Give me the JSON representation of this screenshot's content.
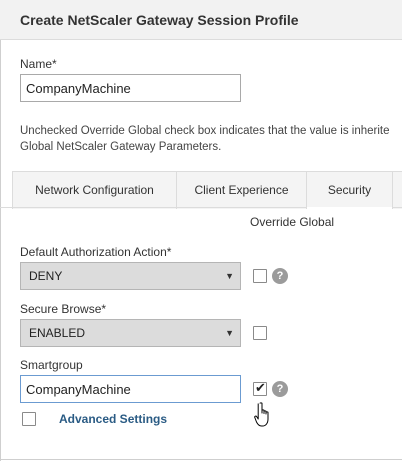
{
  "window": {
    "title": "Create NetScaler Gateway Session Profile"
  },
  "name_field": {
    "label": "Name*",
    "value": "CompanyMachine"
  },
  "info_text": {
    "line1": "Unchecked Override Global check box indicates that the value is inherite",
    "line2": "Global NetScaler Gateway Parameters."
  },
  "tabs": [
    {
      "label": "Network Configuration",
      "active": false
    },
    {
      "label": "Client Experience",
      "active": false
    },
    {
      "label": "Security",
      "active": true
    }
  ],
  "override_global_header": "Override Global",
  "default_authorization": {
    "label": "Default Authorization Action*",
    "value": "DENY",
    "override": false
  },
  "secure_browse": {
    "label": "Secure Browse*",
    "value": "ENABLED",
    "override": false
  },
  "smartgroup": {
    "label": "Smartgroup",
    "value": "CompanyMachine",
    "override": true
  },
  "advanced_settings": {
    "label": "Advanced Settings",
    "checked": false
  },
  "icons": {
    "dropdown_arrow": "▼",
    "help": "?",
    "check": "✔"
  },
  "colors": {
    "title_bg": "#f2f2f2",
    "link": "#2a5b84",
    "select_bg": "#dcdcdc",
    "focus_border": "#6b9bd1"
  }
}
